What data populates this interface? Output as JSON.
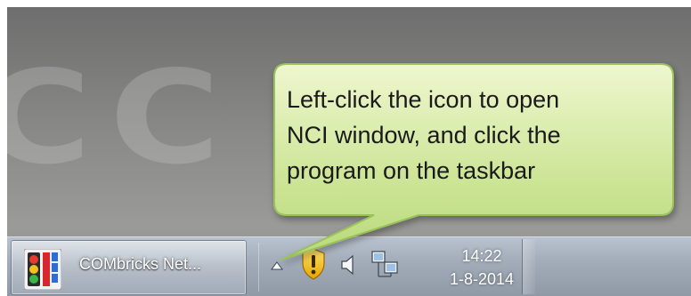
{
  "taskbar": {
    "task_button": {
      "label": "COMbricks Net...",
      "icon": "combricks-app-icon"
    },
    "tray": {
      "icons": [
        "show-hidden-icons-arrow",
        "warning-shield-icon",
        "speaker-icon",
        "network-icon"
      ]
    },
    "clock": {
      "time": "14:22",
      "date": "1-8-2014"
    }
  },
  "callout": {
    "lines": [
      "Left-click the icon to open",
      "NCI window, and click the",
      "program on the taskbar"
    ],
    "colors": {
      "fill_top": "#eef7cf",
      "fill_bottom": "#b9d97a",
      "border": "#9bc25a"
    }
  }
}
